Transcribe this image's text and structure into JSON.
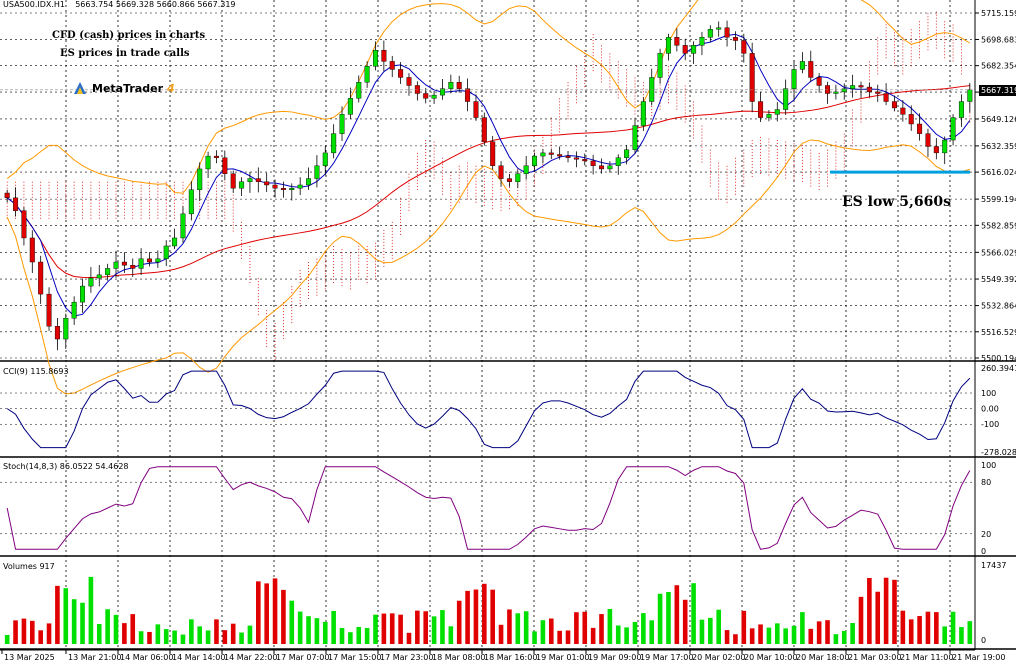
{
  "header": {
    "symbol": "USA500.IDX.H1",
    "ohlc": "5663.754 5669.328 5660.866 5667.319"
  },
  "annotations": {
    "note1": "CFD (cash) prices in charts",
    "note2": "ES prices in trade calls",
    "brand": "MetaTrader",
    "brand_version": "4",
    "es_low": "ES low 5,660s",
    "current_price": "5667.319"
  },
  "colors": {
    "bull": "#00e000",
    "bear": "#e00000",
    "bollinger": "#ff9900",
    "ma_fast": "#0000c0",
    "ma_slow": "#e00000",
    "ichimoku_cloud": "#e00000",
    "cci": "#000080",
    "stoch": "#800080",
    "support_line": "#00a0e0"
  },
  "chart_data": [
    {
      "type": "candlestick",
      "title": "USA500.IDX.H1",
      "price_ticks": [
        "5715.159",
        "5698.683",
        "5682.354",
        "5665.879",
        "5649.126",
        "5632.359",
        "5616.024",
        "5599.194",
        "5582.859",
        "5566.029",
        "5549.392",
        "5532.864",
        "5516.529",
        "5500.194"
      ],
      "ylim": [
        5500.194,
        5715.159
      ],
      "support_level": 5616.024,
      "x_ticks": [
        "13 Mar 2025",
        "13 Mar 21:00",
        "14 Mar 06:00",
        "14 Mar 14:00",
        "14 Mar 22:00",
        "17 Mar 07:00",
        "17 Mar 15:00",
        "17 Mar 23:00",
        "18 Mar 08:00",
        "18 Mar 16:00",
        "19 Mar 01:00",
        "19 Mar 09:00",
        "19 Mar 17:00",
        "20 Mar 02:00",
        "20 Mar 10:00",
        "20 Mar 18:00",
        "21 Mar 03:00",
        "21 Mar 11:00",
        "21 Mar 19:00"
      ],
      "closes": [
        5600,
        5592,
        5575,
        5560,
        5540,
        5520,
        5512,
        5525,
        5535,
        5545,
        5550,
        5552,
        5556,
        5560,
        5558,
        5556,
        5562,
        5560,
        5562,
        5570,
        5575,
        5590,
        5605,
        5618,
        5626,
        5625,
        5615,
        5606,
        5610,
        5612,
        5610,
        5608,
        5606,
        5605,
        5606,
        5608,
        5612,
        5620,
        5628,
        5640,
        5652,
        5662,
        5672,
        5682,
        5692,
        5685,
        5680,
        5675,
        5670,
        5665,
        5662,
        5664,
        5668,
        5672,
        5668,
        5660,
        5650,
        5635,
        5620,
        5612,
        5610,
        5615,
        5620,
        5626,
        5628,
        5627,
        5626,
        5625,
        5624,
        5623,
        5620,
        5618,
        5620,
        5625,
        5630,
        5645,
        5660,
        5675,
        5690,
        5700,
        5695,
        5690,
        5695,
        5700,
        5705,
        5706,
        5700,
        5698,
        5690,
        5660,
        5650,
        5652,
        5655,
        5668,
        5680,
        5685,
        5675,
        5670,
        5665,
        5666,
        5668,
        5670,
        5669,
        5666,
        5665,
        5660,
        5656,
        5652,
        5646,
        5640,
        5632,
        5628,
        5636,
        5650,
        5660,
        5667.319
      ]
    },
    {
      "type": "line",
      "title": "CCI(9) 115.8693",
      "y_ticks": [
        "260.3941",
        "100",
        "0.00",
        "-100",
        "-278.0288"
      ],
      "ylim": [
        -278.0288,
        260.3941
      ]
    },
    {
      "type": "line",
      "title": "Stoch(14,8,3) 86.0522 54.4628",
      "y_ticks": [
        "100",
        "80",
        "20",
        "0"
      ],
      "ylim": [
        0,
        100
      ]
    },
    {
      "type": "bar",
      "title": "Volumes 917",
      "y_ticks": [
        "17437",
        "0"
      ],
      "ylim": [
        0,
        17437
      ]
    }
  ]
}
